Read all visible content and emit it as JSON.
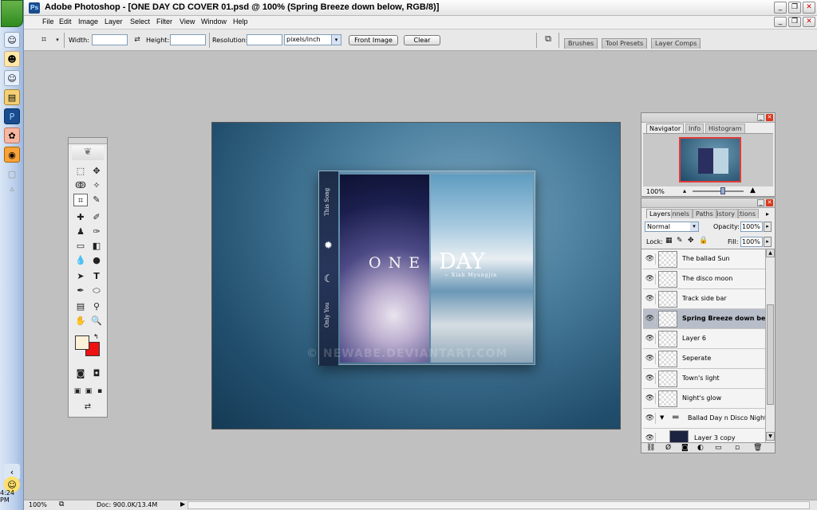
{
  "window": {
    "title": "Adobe Photoshop - [ONE DAY CD COVER 01.psd @ 100% (Spring Breeze down below, RGB/8)]"
  },
  "menu": [
    "File",
    "Edit",
    "Image",
    "Layer",
    "Select",
    "Filter",
    "View",
    "Window",
    "Help"
  ],
  "options": {
    "width_label": "Width:",
    "width_value": "",
    "height_label": "Height:",
    "height_value": "",
    "resolution_label": "Resolution:",
    "resolution_value": "",
    "units_value": "pixels/inch",
    "front_image_label": "Front Image",
    "clear_label": "Clear"
  },
  "palette_well": [
    "Brushes",
    "Tool Presets",
    "Layer Comps"
  ],
  "document": {
    "cover_word_one": "ONE",
    "cover_word_day": "DAY",
    "cover_artist": "~ Xiah Myungjin",
    "spine_top": "This Song",
    "spine_bottom": "Only You",
    "watermark": "© NEWABE.DEVIANTART.COM"
  },
  "navigator": {
    "tabs": [
      "Navigator",
      "Info",
      "Histogram"
    ],
    "zoom": "100%"
  },
  "layers_panel": {
    "tabs": [
      "Layers",
      "Channels",
      "Paths",
      "History",
      "Actions"
    ],
    "blend_mode": "Normal",
    "opacity_label": "Opacity:",
    "opacity_value": "100%",
    "lock_label": "Lock:",
    "fill_label": "Fill:",
    "fill_value": "100%",
    "layers": [
      {
        "name": "The ballad Sun",
        "selected": false
      },
      {
        "name": "The disco moon",
        "selected": false
      },
      {
        "name": "Track side bar",
        "selected": false
      },
      {
        "name": "Spring Breeze down be...",
        "selected": true
      },
      {
        "name": "Layer 6",
        "selected": false
      },
      {
        "name": "Seperate",
        "selected": false
      },
      {
        "name": "Town's light",
        "selected": false
      },
      {
        "name": "Night's glow",
        "selected": false
      },
      {
        "name": "Ballad Day n Disco Night",
        "selected": false
      },
      {
        "name": "Layer 3 copy",
        "selected": false
      }
    ]
  },
  "statusbar": {
    "zoom": "100%",
    "doc_size": "Doc: 900.0K/13.4M"
  },
  "taskbar": {
    "clock": "4:24 PM"
  },
  "colors": {
    "foreground": "#fbf0d8",
    "background": "#ee1111"
  }
}
